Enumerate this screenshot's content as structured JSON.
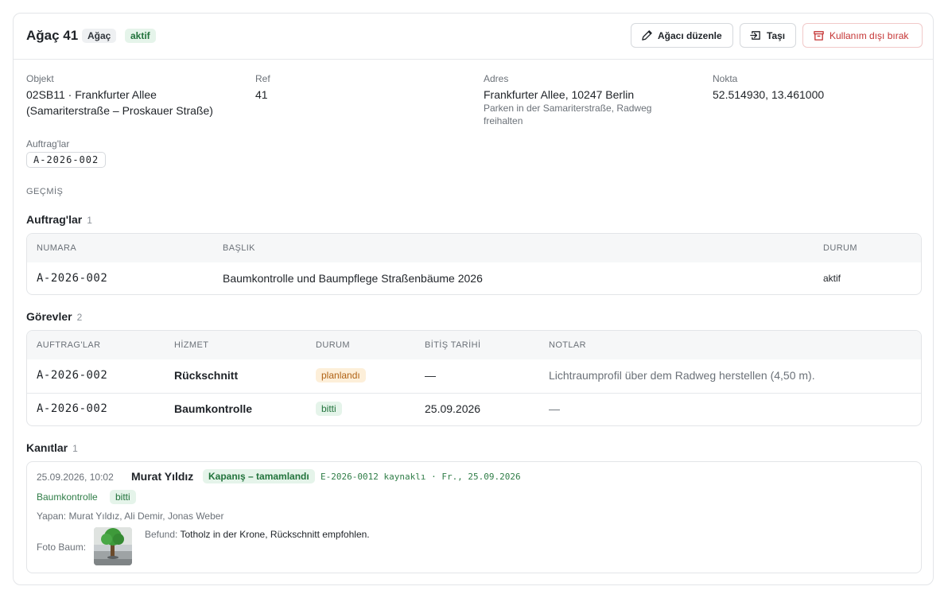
{
  "header": {
    "title": "Ağaç 41",
    "type_badge": "Ağaç",
    "status_badge": "aktif",
    "edit_label": "Ağacı düzenle",
    "move_label": "Taşı",
    "retire_label": "Kullanım dışı bırak"
  },
  "info": {
    "objekt_label": "Objekt",
    "objekt_value_1": "02SB11 · Frankfurter Allee",
    "objekt_value_2": "(Samariterstraße – Proskauer Straße)",
    "ref_label": "Ref",
    "ref_value": "41",
    "adres_label": "Adres",
    "adres_value": "Frankfurter Allee, 10247 Berlin",
    "adres_note_1": "Parken in der Samariterstraße, Radweg",
    "adres_note_2": "freihalten",
    "nokta_label": "Nokta",
    "nokta_value": "52.514930, 13.461000",
    "auftrag_label": "Auftrag'lar",
    "auftrag_chip": "A-2026-002"
  },
  "history_caption": "GEÇMİŞ",
  "auftraege": {
    "title": "Auftrag'lar",
    "count": "1",
    "columns": [
      "NUMARA",
      "BAŞLIK",
      "DURUM"
    ],
    "rows": [
      {
        "number": "A-2026-002",
        "title": "Baumkontrolle und Baumpflege Straßenbäume 2026",
        "status": "aktif"
      }
    ]
  },
  "tasks": {
    "title": "Görevler",
    "count": "2",
    "columns": [
      "AUFTRAG'LAR",
      "HİZMET",
      "DURUM",
      "BİTİŞ TARİHİ",
      "NOTLAR"
    ],
    "rows": [
      {
        "auftrag": "A-2026-002",
        "service": "Rückschnitt",
        "status": "planlandı",
        "due": "—",
        "notes": "Lichtraumprofil über dem Radweg herstellen (4,50 m)."
      },
      {
        "auftrag": "A-2026-002",
        "service": "Baumkontrolle",
        "status": "bitti",
        "due": "25.09.2026",
        "notes": "—"
      }
    ]
  },
  "evidence": {
    "title": "Kanıtlar",
    "count": "1",
    "items": [
      {
        "timestamp": "25.09.2026, 10:02",
        "author": "Murat Yıldız",
        "tag": "Kapanış – tamamlandı",
        "source": "E-2026-0012 kaynaklı · Fr., 25.09.2026",
        "service": "Baumkontrolle",
        "service_status": "bitti",
        "performers": "Yapan: Murat Yıldız, Ali Demir, Jonas Weber",
        "photo_label": "Foto Baum:",
        "finding_label": "Befund:",
        "finding_text": "Totholz in der Krone, Rückschnitt empfohlen."
      }
    ]
  },
  "colors": {
    "accent_green": "#22733c",
    "danger_red": "#c53535",
    "warning_orange": "#b06214"
  }
}
